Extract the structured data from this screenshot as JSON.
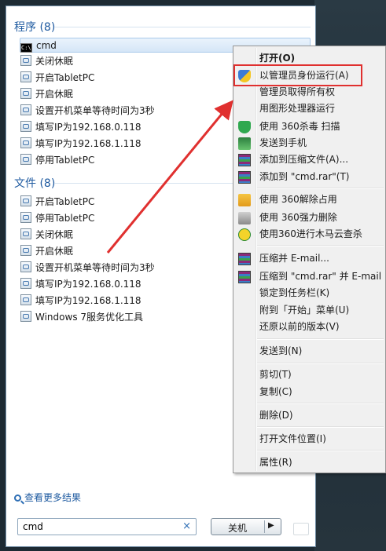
{
  "programs": {
    "header": "程序 (8)",
    "items": [
      {
        "label": "cmd",
        "icon": "cmd-icon",
        "selected": true
      },
      {
        "label": "关闭休眠",
        "icon": "shortcut-icon"
      },
      {
        "label": "开启TabletPC",
        "icon": "shortcut-icon"
      },
      {
        "label": "开启休眠",
        "icon": "shortcut-icon"
      },
      {
        "label": "设置开机菜单等待时间为3秒",
        "icon": "shortcut-icon"
      },
      {
        "label": "填写IP为192.168.0.118",
        "icon": "shortcut-icon"
      },
      {
        "label": "填写IP为192.168.1.118",
        "icon": "shortcut-icon"
      },
      {
        "label": "停用TabletPC",
        "icon": "shortcut-icon"
      }
    ]
  },
  "files": {
    "header": "文件 (8)",
    "items": [
      {
        "label": "开启TabletPC"
      },
      {
        "label": "停用TabletPC"
      },
      {
        "label": "关闭休眠"
      },
      {
        "label": "开启休眠"
      },
      {
        "label": "设置开机菜单等待时间为3秒"
      },
      {
        "label": "填写IP为192.168.0.118"
      },
      {
        "label": "填写IP为192.168.1.118"
      },
      {
        "label": "Windows 7服务优化工具"
      }
    ]
  },
  "more_results": "查看更多结果",
  "search": {
    "value": "cmd",
    "clear": "×"
  },
  "shutdown": {
    "label": "关机",
    "arrow": "▶"
  },
  "context_menu": {
    "items": [
      {
        "label": "打开(O)",
        "bold": true
      },
      {
        "label": "以管理员身份运行(A)",
        "icon": "uac-shield-icon",
        "highlighted": true
      },
      {
        "label": "管理员取得所有权"
      },
      {
        "label": "用图形处理器运行"
      },
      {
        "label": "使用 360杀毒 扫描",
        "icon": "360-shield-icon"
      },
      {
        "label": "发送到手机",
        "icon": "phone-icon"
      },
      {
        "label": "添加到压缩文件(A)...",
        "icon": "winrar-icon"
      },
      {
        "label": "添加到 \"cmd.rar\"(T)",
        "icon": "winrar-icon"
      },
      {
        "label": "使用 360解除占用",
        "icon": "360-unlock-icon"
      },
      {
        "label": "使用 360强力删除",
        "icon": "360-delete-icon"
      },
      {
        "label": "使用360进行木马云查杀",
        "icon": "360-cloud-icon"
      },
      {
        "label": "压缩并 E-mail...",
        "icon": "winrar-icon"
      },
      {
        "label": "压缩到 \"cmd.rar\" 并 E-mail",
        "icon": "winrar-icon"
      },
      {
        "label": "锁定到任务栏(K)"
      },
      {
        "label": "附到「开始」菜单(U)"
      },
      {
        "label": "还原以前的版本(V)"
      },
      {
        "label": "发送到(N)"
      },
      {
        "label": "剪切(T)"
      },
      {
        "label": "复制(C)"
      },
      {
        "label": "删除(D)"
      },
      {
        "label": "打开文件位置(I)"
      },
      {
        "label": "属性(R)"
      }
    ]
  },
  "colors": {
    "annotation_red": "#e0302f",
    "section_blue": "#1e5aa0"
  }
}
